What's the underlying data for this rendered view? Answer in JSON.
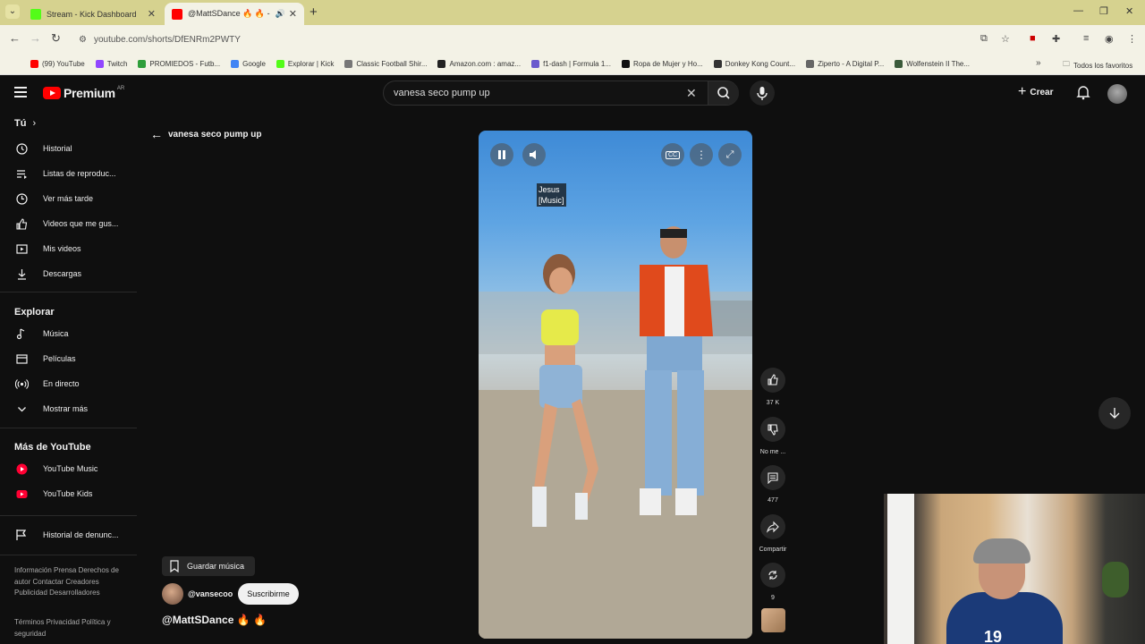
{
  "browser": {
    "tabs": [
      {
        "title": "Stream - Kick Dashboard",
        "color": "#53fc18"
      },
      {
        "title": "@MattSDance 🔥 🔥 - You",
        "color": "#ff0000"
      }
    ],
    "url": "youtube.com/shorts/DfENRm2PWTY",
    "bookmarks": [
      {
        "label": "(99) YouTube",
        "color": "#ff0000"
      },
      {
        "label": "Twitch",
        "color": "#9146ff"
      },
      {
        "label": "PROMIEDOS - Futb...",
        "color": "#2e9e3a"
      },
      {
        "label": "Google",
        "color": "#4285f4"
      },
      {
        "label": "Explorar | Kick",
        "color": "#53fc18"
      },
      {
        "label": "Classic Football Shir...",
        "color": "#777777"
      },
      {
        "label": "Amazon.com : amaz...",
        "color": "#222222"
      },
      {
        "label": "f1-dash | Formula 1...",
        "color": "#6a5acd"
      },
      {
        "label": "Ropa de Mujer y Ho...",
        "color": "#111111"
      },
      {
        "label": "Donkey Kong Count...",
        "color": "#333333"
      },
      {
        "label": "Ziperto - A Digital P...",
        "color": "#666666"
      },
      {
        "label": "Wolfenstein II The...",
        "color": "#3a5a3a"
      }
    ],
    "bookmarks_all": "Todos los favoritos"
  },
  "header": {
    "logo_text": "Premium",
    "country": "AR",
    "search_query": "vanesa seco pump up",
    "create_label": "Crear"
  },
  "sidebar": {
    "you_heading": "Tú",
    "you_items": [
      "Historial",
      "Listas de reproduc...",
      "Ver más tarde",
      "Videos que me gus...",
      "Mis videos",
      "Descargas"
    ],
    "explore_heading": "Explorar",
    "explore_items": [
      "Música",
      "Películas",
      "En directo",
      "Mostrar más"
    ],
    "more_heading": "Más de YouTube",
    "more_items": [
      "YouTube Music",
      "YouTube Kids"
    ],
    "report_item": "Historial de denunc...",
    "footer1": "Información  Prensa  Derechos de autor  Contactar  Creadores  Publicidad  Desarrolladores",
    "footer2": "Términos  Privacidad  Política y seguridad"
  },
  "main": {
    "back_label": "vanesa seco pump up",
    "caption_line1": "Jesus",
    "caption_line2": "[Music]",
    "likes": "37 K",
    "dislike_label": "No me ...",
    "comments": "477",
    "share_label": "Compartir",
    "remix_count": "9",
    "save_music_label": "Guardar música",
    "channel_handle": "@vansecoo",
    "subscribe_label": "Suscribirme",
    "short_title": "@MattSDance 🔥 🔥"
  },
  "webcam": {
    "jersey_number": "19"
  }
}
